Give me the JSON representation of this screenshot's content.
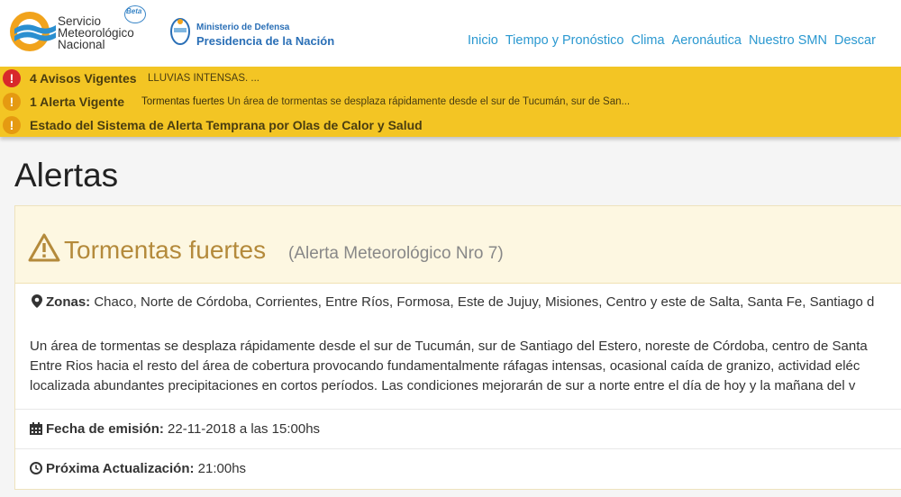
{
  "header": {
    "logo_lines": [
      "Servicio",
      "Meteorológico",
      "Nacional"
    ],
    "beta": "Beta",
    "ministerio": "Ministerio de Defensa",
    "presidencia": "Presidencia de la Nación",
    "nav": [
      "Inicio",
      "Tiempo y Pronóstico",
      "Clima",
      "Aeronáutica",
      "Nuestro SMN",
      "Descar"
    ]
  },
  "alerts": [
    {
      "title": "4 Avisos Vigentes",
      "desc": "LLUVIAS INTENSAS. ...",
      "color": "#d8282b"
    },
    {
      "title": "1 Alerta Vigente",
      "desc_bold": "Tormentas fuertes",
      "desc": "Un área de tormentas se desplaza rápidamente desde el sur de Tucumán, sur de San...",
      "color": "#e59a11"
    },
    {
      "title": "Estado del Sistema de Alerta Temprana por Olas de Calor y Salud",
      "color": "#e59a11"
    }
  ],
  "page": {
    "title": "Alertas"
  },
  "alert_panel": {
    "title": "Tormentas fuertes",
    "subtitle": "(Alerta Meteorológico Nro 7)",
    "zonas_label": "Zonas:",
    "zonas": "Chaco, Norte de Córdoba, Corrientes, Entre Ríos, Formosa, Este de Jujuy, Misiones, Centro y este de Salta, Santa Fe, Santiago d",
    "body_lines": [
      "Un área de tormentas se desplaza rápidamente desde el sur de Tucumán, sur de Santiago del Estero, noreste de Córdoba, centro de Santa",
      "Entre Rios hacia el resto del área de cobertura provocando fundamentalmente ráfagas intensas, ocasional caída de granizo, actividad eléc",
      "localizada abundantes precipitaciones en cortos períodos. Las condiciones mejorarán de sur a norte entre el día de hoy y la mañana del v"
    ],
    "fecha_label": "Fecha de emisión:",
    "fecha_value": "22-11-2018 a las 15:00hs",
    "proxima_label": "Próxima Actualización:",
    "proxima_value": "21:00hs"
  }
}
